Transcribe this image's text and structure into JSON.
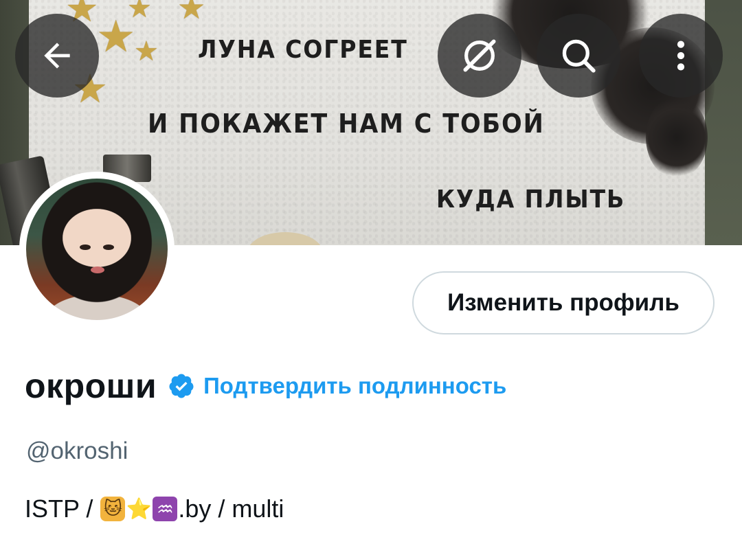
{
  "banner": {
    "poem_line_1": "ЛУНА СОГРЕЕТ",
    "poem_line_2": "И ПОКАЖЕТ НАМ С ТОБОЙ",
    "poem_line_3": "КУДА ПЛЫТЬ"
  },
  "toolbar": {
    "back_icon": "arrow-left-icon",
    "hide_media_icon": "no-image-icon",
    "search_icon": "search-icon",
    "more_icon": "more-vertical-icon"
  },
  "profile": {
    "edit_button_label": "Изменить профиль",
    "display_name": "окроши",
    "verify_link": "Подтвердить подлинность",
    "handle": "@okroshi",
    "bio_prefix": "ISTP / ",
    "bio_emojis": [
      "🐱",
      "⭐",
      "♒"
    ],
    "bio_suffix": ".by / multi"
  },
  "colors": {
    "accent": "#1d9bf0",
    "text_primary": "#0f1419",
    "text_secondary": "#536471"
  }
}
